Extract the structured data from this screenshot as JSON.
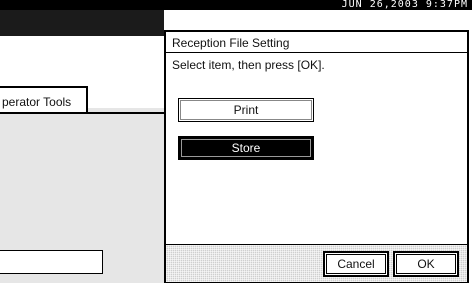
{
  "status_bar": {
    "datetime": "JUN  26,2003  9:37PM"
  },
  "background": {
    "tab_label": "perator Tools"
  },
  "dialog": {
    "title": "Reception File Setting",
    "instruction": "Select item, then press [OK].",
    "options": [
      {
        "label": "Print",
        "selected": false
      },
      {
        "label": "Store",
        "selected": true
      }
    ],
    "cancel_label": "Cancel",
    "ok_label": "OK"
  }
}
